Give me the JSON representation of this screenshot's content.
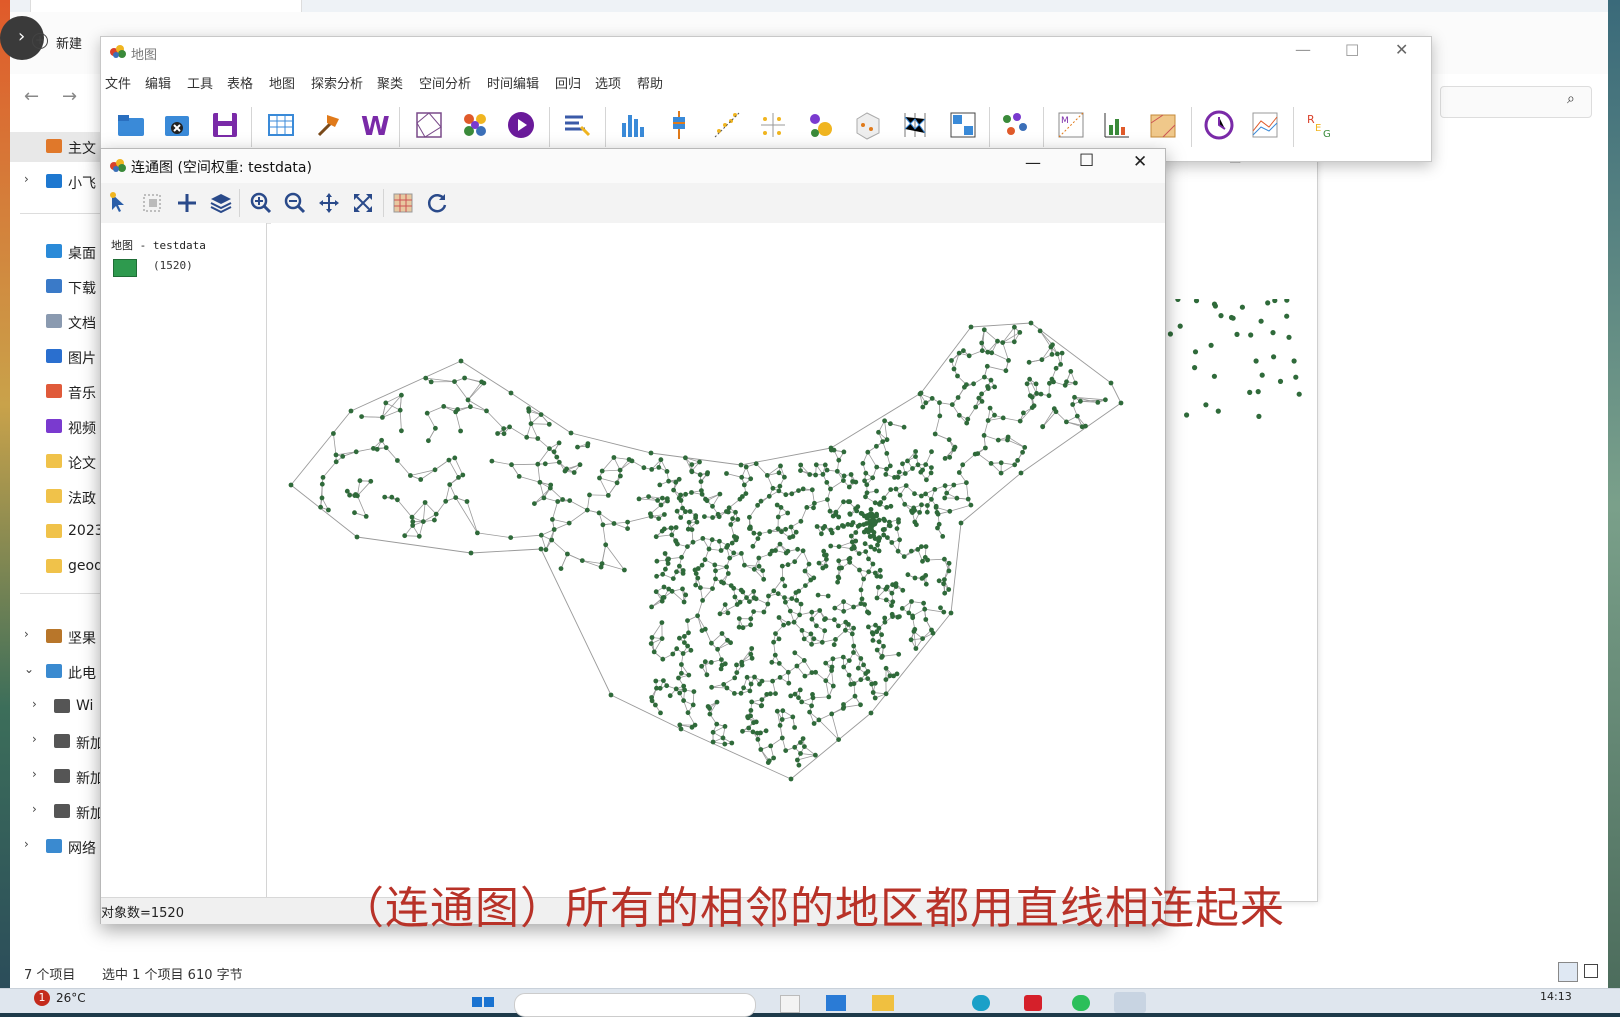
{
  "explorer": {
    "new_label": "新建",
    "sidebar": [
      {
        "label": "主文",
        "icon": "home-icon",
        "chev": ""
      },
      {
        "label": "小飞",
        "icon": "cloud-icon",
        "chev": ">"
      },
      {
        "label": "桌面",
        "icon": "desktop-icon",
        "chev": ""
      },
      {
        "label": "下载",
        "icon": "download-icon",
        "chev": ""
      },
      {
        "label": "文档",
        "icon": "document-icon",
        "chev": ""
      },
      {
        "label": "图片",
        "icon": "picture-icon",
        "chev": ""
      },
      {
        "label": "音乐",
        "icon": "music-icon",
        "chev": ""
      },
      {
        "label": "视频",
        "icon": "video-icon",
        "chev": ""
      },
      {
        "label": "论文",
        "icon": "folder-icon",
        "chev": ""
      },
      {
        "label": "法政",
        "icon": "folder-icon",
        "chev": ""
      },
      {
        "label": "2023",
        "icon": "folder-icon",
        "chev": ""
      },
      {
        "label": "geod",
        "icon": "folder-icon",
        "chev": ""
      },
      {
        "label": "坚果",
        "icon": "nut-icon",
        "chev": ">"
      },
      {
        "label": "此电",
        "icon": "pc-icon",
        "chev": "v"
      },
      {
        "label": "Wi",
        "icon": "drive-icon",
        "chev": ">"
      },
      {
        "label": "新加",
        "icon": "drive-icon",
        "chev": ">"
      },
      {
        "label": "新加",
        "icon": "drive-icon",
        "chev": ">"
      },
      {
        "label": "新加",
        "icon": "drive-icon",
        "chev": ">"
      },
      {
        "label": "网络",
        "icon": "network-icon",
        "chev": ">"
      }
    ],
    "status_count": "7 个项目",
    "status_selected": "选中 1 个项目  610 字节"
  },
  "mainwin": {
    "title": "地图",
    "menu": [
      "文件",
      "编辑",
      "工具",
      "表格",
      "地图",
      "探索分析",
      "聚类",
      "空间分析",
      "时间编辑",
      "回归",
      "选项",
      "帮助"
    ]
  },
  "conwin": {
    "title": "连通图 (空间权重:  testdata)",
    "legend_title": "地图 - testdata",
    "legend_count": "(1520)",
    "status": "对象数=1520"
  },
  "caption": "（连通图）所有的相邻的地区都用直线相连起来",
  "taskbar": {
    "weather": "26°C",
    "notif": "1",
    "time": "14:13"
  },
  "colors": {
    "node": "#2f6a3a",
    "edge": "#9a9a9a",
    "legend_swatch": "#2e9a4e",
    "caption": "#b83228"
  }
}
